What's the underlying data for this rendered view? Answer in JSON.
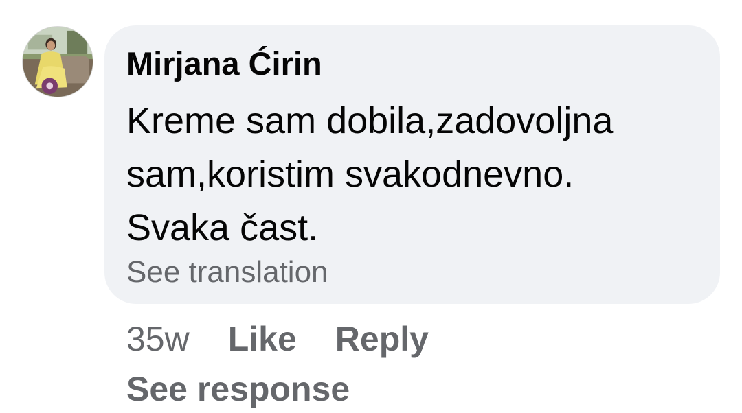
{
  "comment": {
    "author": "Mirjana Ćirin",
    "avatar_icon": "profile-photo-avatar",
    "text_lines": [
      "Kreme sam dobila,zadovoljna",
      "sam,koristim svakodnevno.",
      "Svaka čast."
    ],
    "see_translation_label": "See translation",
    "timestamp": "35w",
    "like_label": "Like",
    "reply_label": "Reply",
    "see_response_label": "See response"
  },
  "colors": {
    "bubble_background": "#f0f2f5",
    "primary_text": "#050505",
    "secondary_text": "#65676b"
  }
}
